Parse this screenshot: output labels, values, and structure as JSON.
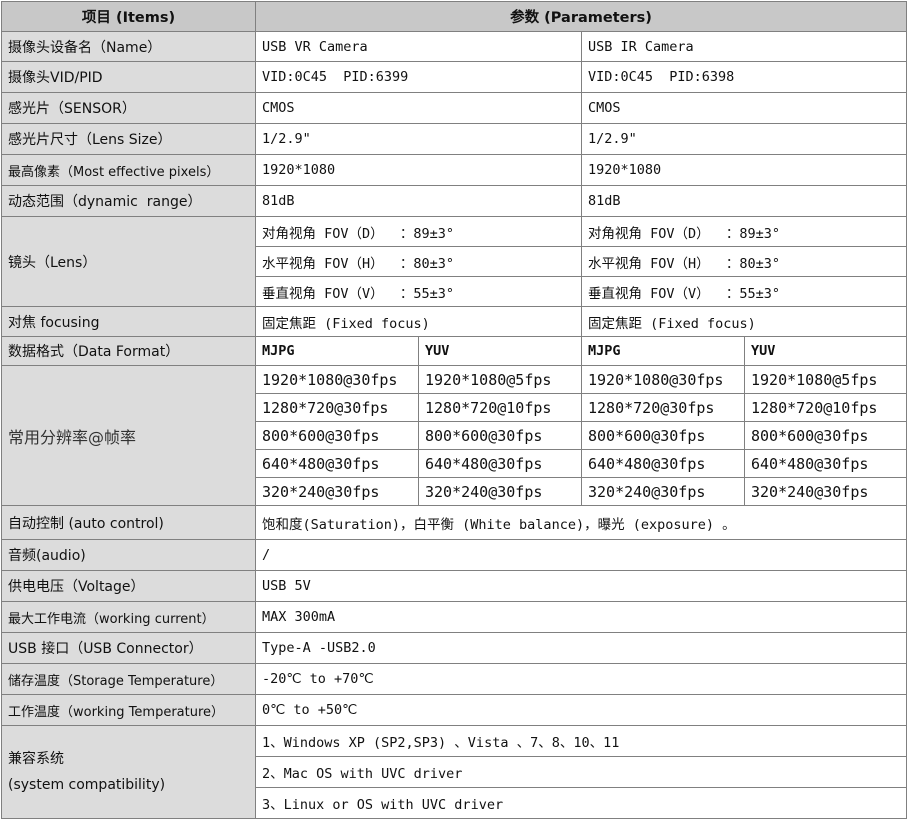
{
  "header": {
    "items": "项目 (Items)",
    "parameters": "参数  (Parameters)"
  },
  "rows": {
    "camera_name": {
      "label": "摄像头设备名（Name）",
      "vr": "USB VR Camera",
      "ir": "USB IR Camera"
    },
    "vid_pid": {
      "label": "摄像头VID/PID",
      "vr": "VID:0C45  PID:6399",
      "ir": "VID:0C45  PID:6398"
    },
    "sensor": {
      "label": "感光片（SENSOR）",
      "vr": "CMOS",
      "ir": "CMOS"
    },
    "lens_size": {
      "label": "感光片尺寸（Lens Size）",
      "vr": "1/2.9\"",
      "ir": "1/2.9\""
    },
    "pixels": {
      "label": "最高像素（Most effective pixels）",
      "vr": "1920*1080",
      "ir": "1920*1080"
    },
    "dynamic_range": {
      "label": "动态范围（dynamic  range）",
      "vr": "81dB",
      "ir": "81dB"
    },
    "lens": {
      "label": "镜头（Lens）",
      "fov_d": "对角视角 FOV（D）  ：89±3°",
      "fov_h": "水平视角 FOV（H）  ：80±3°",
      "fov_v": "垂直视角 FOV（V）  ：55±3°"
    },
    "focusing": {
      "label": "对焦 focusing",
      "value": "固定焦距 (Fixed focus)"
    },
    "data_format": {
      "label": "数据格式（Data Format）",
      "mjpg": "MJPG",
      "yuv": "YUV"
    },
    "resolutions": {
      "label": "常用分辨率@帧率",
      "list": [
        {
          "mjpg": "1920*1080@30fps",
          "yuv": "1920*1080@5fps"
        },
        {
          "mjpg": "1280*720@30fps",
          "yuv": "1280*720@10fps"
        },
        {
          "mjpg": "800*600@30fps",
          "yuv": "800*600@30fps"
        },
        {
          "mjpg": "640*480@30fps",
          "yuv": "640*480@30fps"
        },
        {
          "mjpg": "320*240@30fps",
          "yuv": "320*240@30fps"
        }
      ]
    },
    "auto_control": {
      "label": "自动控制 (auto control)",
      "value": "饱和度(Saturation)，白平衡 (White balance)，曝光 (exposure) 。"
    },
    "audio": {
      "label": "音频(audio)",
      "value": "/"
    },
    "voltage": {
      "label": "供电电压（Voltage）",
      "value": "USB 5V"
    },
    "current": {
      "label": "最大工作电流（working current）",
      "value": "MAX 300mA"
    },
    "usb": {
      "label": "USB 接口（USB Connector）",
      "value": "Type-A -USB2.0"
    },
    "storage_temp": {
      "label": "储存温度（Storage Temperature）",
      "value": "-20℃ to +70℃"
    },
    "working_temp": {
      "label": "工作温度（working Temperature）",
      "value": "0℃ to +50℃"
    },
    "compat": {
      "label_cn": "兼容系统",
      "label_en": "(system compatibility)",
      "items": [
        "1、Windows XP (SP2,SP3) 、Vista 、7、8、10、11",
        "2、Mac OS with UVC driver",
        "3、Linux or OS with UVC driver"
      ]
    }
  }
}
